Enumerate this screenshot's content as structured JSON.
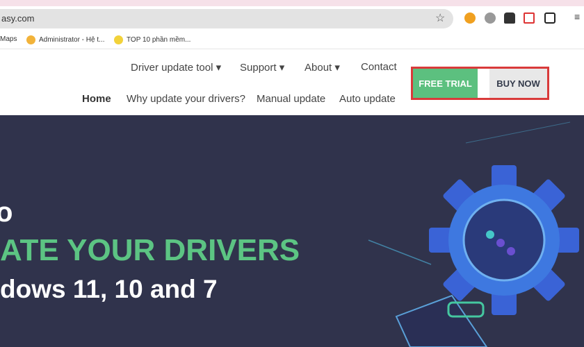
{
  "browser": {
    "url": "asy.com",
    "bookmarks": [
      {
        "label": "Maps"
      },
      {
        "label": "Administrator - Hệ t..."
      },
      {
        "label": "TOP 10 phần mềm..."
      }
    ],
    "extension_icons": [
      "flower-extension-icon",
      "gear-extension-icon",
      "spy-extension-icon",
      "vm-extension-icon",
      "puzzle-extensions-icon",
      "reading-list-icon"
    ]
  },
  "nav": {
    "primary": [
      {
        "label": "Driver update tool ▾"
      },
      {
        "label": "Support ▾"
      },
      {
        "label": "About ▾"
      },
      {
        "label": "Contact"
      }
    ],
    "secondary": [
      {
        "label": "Home"
      },
      {
        "label": "Why update your drivers?"
      },
      {
        "label": "Manual update"
      },
      {
        "label": "Auto update"
      }
    ],
    "free_trial": "FREE TRIAL",
    "buy_now": "BUY NOW"
  },
  "hero": {
    "line1": "o",
    "line2": "ATE YOUR DRIVERS",
    "line3": "dows 11, 10 and 7"
  },
  "colors": {
    "accent_green": "#5cc07f",
    "hero_bg": "#30334c",
    "highlight_red": "#d93a3a"
  }
}
